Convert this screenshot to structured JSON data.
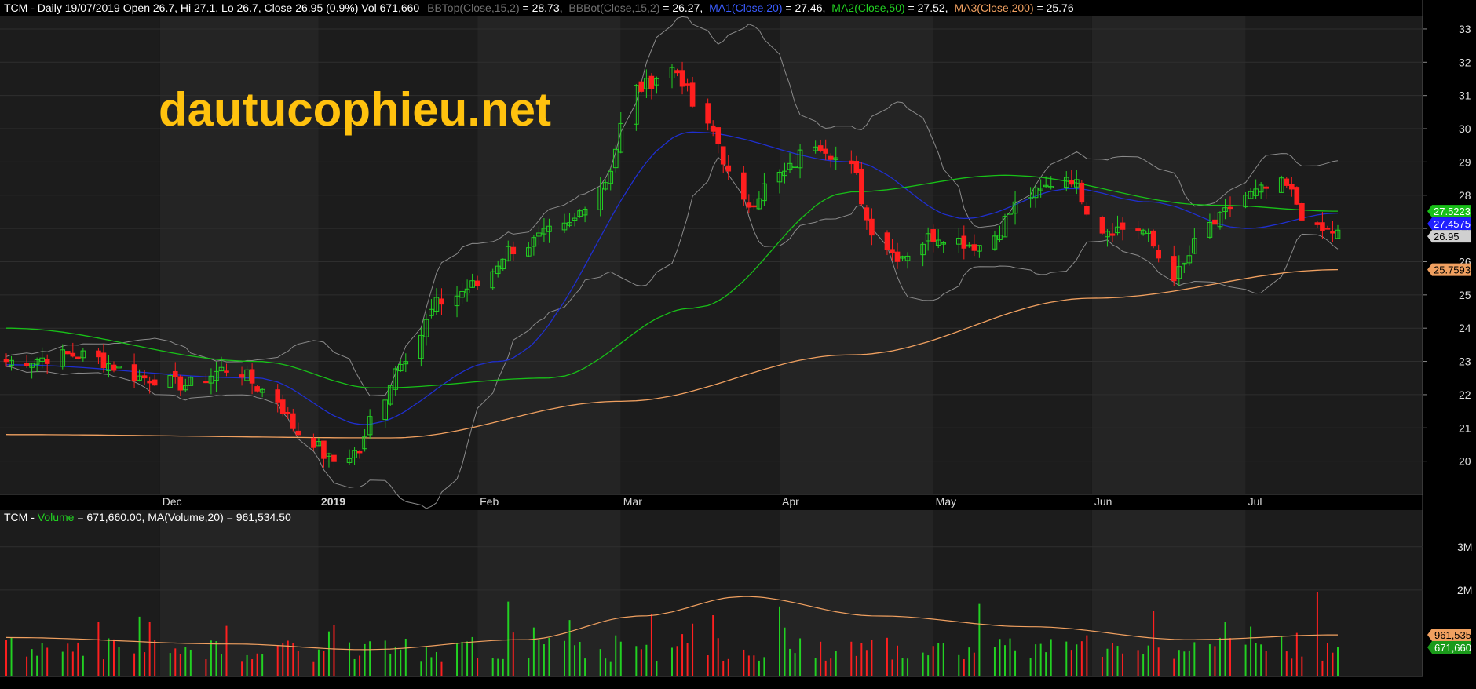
{
  "header": {
    "price_prefix": "TCM - Daily 19/07/2019 Open 26.7, Hi 27.1, Lo 26.7, Close 26.95 (0.9%) Vol 671,660",
    "bbtop_label": "BBTop(Close,15,2)",
    "bbtop_value": " = 28.73,",
    "bbbot_label": "BBBot(Close,15,2)",
    "bbbot_value": " = 26.27,",
    "ma1_label": "MA1(Close,20)",
    "ma1_value": " = 27.46,",
    "ma2_label": "MA2(Close,50)",
    "ma2_value": " = 27.52,",
    "ma3_label": "MA3(Close,200)",
    "ma3_value": " = 25.76",
    "volume_prefix": "TCM - ",
    "volume_label": "Volume",
    "volume_value": " = 671,660.00, MA(Volume,20) = 961,534.50"
  },
  "watermark": "dautucophieu.net",
  "colors": {
    "background": "#000000",
    "panel": "#1c1c1c",
    "panel_alt": "#242424",
    "up": "#22d122",
    "down": "#ff1f1f",
    "bollinger": "#8a8a8a",
    "ma1": "#1f2fd0",
    "ma2": "#18c018",
    "ma3": "#f0a060",
    "watermark": "#ffc20e"
  },
  "chart_data": [
    {
      "type": "candlestick",
      "title": "TCM - Daily 19/07/2019",
      "x_months": [
        "Dec",
        "2019",
        "Feb",
        "Mar",
        "Apr",
        "May",
        "Jun",
        "Jul"
      ],
      "y_ticks": [
        20,
        21,
        22,
        23,
        24,
        25,
        26,
        27,
        28,
        29,
        30,
        31,
        32,
        33
      ],
      "ylim": [
        19.0,
        33.4
      ],
      "last_bar": {
        "date": "19/07/2019",
        "open": 26.7,
        "high": 27.1,
        "low": 26.7,
        "close": 26.95,
        "change_pct": 0.9
      },
      "close_path_approx": [
        [
          "2018-11-01",
          23.0
        ],
        [
          "2018-11-15",
          23.2
        ],
        [
          "2018-11-29",
          22.5
        ],
        [
          "2018-12-06",
          22.3
        ],
        [
          "2018-12-15",
          22.8
        ],
        [
          "2018-12-22",
          22.1
        ],
        [
          "2018-12-29",
          20.8
        ],
        [
          "2019-01-04",
          20.0
        ],
        [
          "2019-01-09",
          20.3
        ],
        [
          "2019-01-12",
          21.6
        ],
        [
          "2019-01-18",
          23.2
        ],
        [
          "2019-01-25",
          24.8
        ],
        [
          "2019-02-01",
          25.3
        ],
        [
          "2019-02-08",
          26.4
        ],
        [
          "2019-02-18",
          27.0
        ],
        [
          "2019-02-25",
          28.3
        ],
        [
          "2019-03-04",
          31.2
        ],
        [
          "2019-03-11",
          31.8
        ],
        [
          "2019-03-18",
          30.0
        ],
        [
          "2019-03-25",
          27.7
        ],
        [
          "2019-04-01",
          28.6
        ],
        [
          "2019-04-08",
          29.6
        ],
        [
          "2019-04-15",
          28.8
        ],
        [
          "2019-04-19",
          27.0
        ],
        [
          "2019-04-24",
          26.2
        ],
        [
          "2019-05-02",
          26.8
        ],
        [
          "2019-05-10",
          26.5
        ],
        [
          "2019-05-20",
          28.0
        ],
        [
          "2019-05-27",
          28.6
        ],
        [
          "2019-06-03",
          27.0
        ],
        [
          "2019-06-10",
          27.0
        ],
        [
          "2019-06-17",
          25.6
        ],
        [
          "2019-06-24",
          27.1
        ],
        [
          "2019-07-01",
          28.0
        ],
        [
          "2019-07-08",
          28.3
        ],
        [
          "2019-07-15",
          26.9
        ],
        [
          "2019-07-19",
          26.95
        ]
      ],
      "series": [
        {
          "name": "BBTop(Close,15,2)",
          "last": 28.73
        },
        {
          "name": "BBBot(Close,15,2)",
          "last": 26.27
        },
        {
          "name": "MA1(Close,20)",
          "last": 27.46,
          "path_approx": [
            [
              "2018-11-01",
              22.9
            ],
            [
              "2018-12-20",
              22.5
            ],
            [
              "2019-01-10",
              21.1
            ],
            [
              "2019-02-05",
              23.0
            ],
            [
              "2019-03-15",
              29.9
            ],
            [
              "2019-04-15",
              29.0
            ],
            [
              "2019-05-07",
              27.3
            ],
            [
              "2019-05-28",
              28.2
            ],
            [
              "2019-06-12",
              27.8
            ],
            [
              "2019-07-01",
              27.0
            ],
            [
              "2019-07-19",
              27.46
            ]
          ]
        },
        {
          "name": "MA2(Close,50)",
          "last": 27.52,
          "path_approx": [
            [
              "2018-11-01",
              24.0
            ],
            [
              "2018-12-20",
              23.0
            ],
            [
              "2019-01-12",
              22.2
            ],
            [
              "2019-02-15",
              22.5
            ],
            [
              "2019-03-15",
              24.6
            ],
            [
              "2019-04-15",
              28.1
            ],
            [
              "2019-05-15",
              28.6
            ],
            [
              "2019-06-25",
              27.7
            ],
            [
              "2019-07-19",
              27.52
            ]
          ]
        },
        {
          "name": "MA3(Close,200)",
          "last": 25.76,
          "path_approx": [
            [
              "2018-11-01",
              20.8
            ],
            [
              "2019-01-15",
              20.7
            ],
            [
              "2019-03-01",
              21.8
            ],
            [
              "2019-04-15",
              23.2
            ],
            [
              "2019-06-01",
              24.9
            ],
            [
              "2019-07-19",
              25.76
            ]
          ]
        }
      ],
      "price_tags": [
        "27.5223",
        "27.4575",
        "26.95",
        "25.7593"
      ]
    },
    {
      "type": "bar",
      "title": "Volume",
      "y_ticks": [
        "2M",
        "3M"
      ],
      "series": [
        {
          "name": "Volume",
          "last": 671660.0
        },
        {
          "name": "MA(Volume,20)",
          "last": 961534.5
        }
      ],
      "value_tags": [
        "961,535",
        "671,660"
      ]
    }
  ]
}
